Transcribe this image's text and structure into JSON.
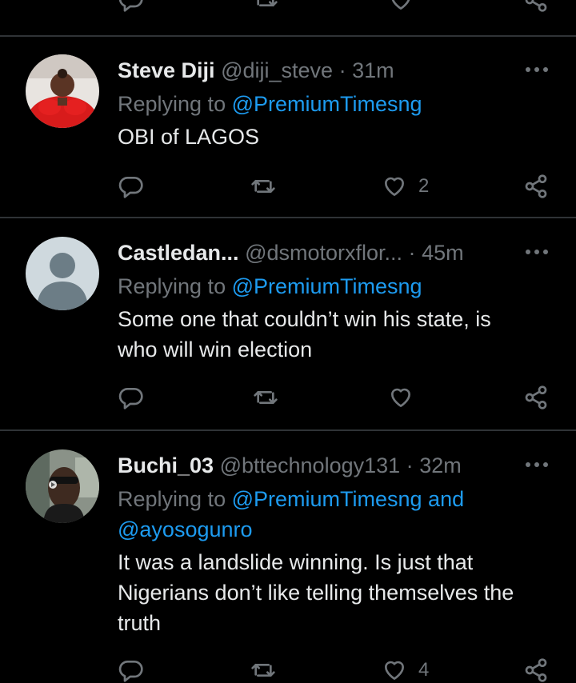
{
  "tweets": [
    {
      "name": "Steve Diji",
      "handle": "@diji_steve",
      "time": "31m",
      "replying_prefix": "Replying to",
      "replying_to": "@PremiumTimesng",
      "text": "OBI of LAGOS",
      "likes": "2"
    },
    {
      "name": "Castledan...",
      "handle": "@dsmotorxflor...",
      "time": "45m",
      "replying_prefix": "Replying to",
      "replying_to": "@PremiumTimesng",
      "text_lines": [
        "Some one that couldn’t win his state, is",
        "who will win election"
      ]
    },
    {
      "name": "Buchi_03",
      "handle": "@bttechnology131",
      "time": "32m",
      "replying_prefix": "Replying to",
      "replying_to": "@PremiumTimesng and",
      "replying_to_2": "@ayosogunro",
      "text_lines": [
        "It was a landslide winning. Is just that",
        "Nigerians don’t like telling themselves the",
        "truth"
      ],
      "likes": "4"
    }
  ],
  "separator": "·",
  "colors": {
    "background": "#000000",
    "text": "#e7e9ea",
    "muted": "#71767b",
    "link": "#1d9bf0",
    "divider": "#2f3336"
  },
  "icons": [
    "reply-icon",
    "retweet-icon",
    "like-icon",
    "share-icon",
    "more-icon"
  ]
}
